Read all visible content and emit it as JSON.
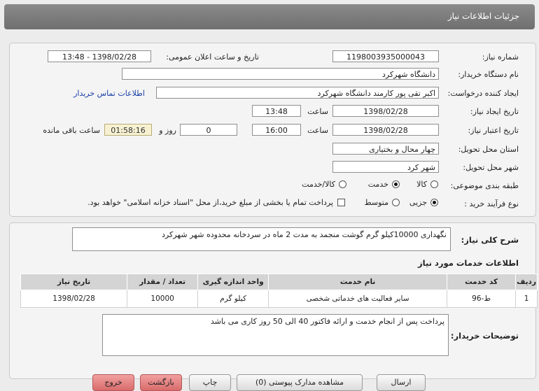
{
  "header": {
    "title": "جزئیات اطلاعات نیاز"
  },
  "form": {
    "need_number_label": "شماره نیاز:",
    "need_number": "1198003935000043",
    "announce_label": "تاریخ و ساعت اعلان عمومی:",
    "announce_value": "1398/02/28 - 13:48",
    "buyer_label": "نام دستگاه خریدار:",
    "buyer": "دانشگاه شهرکرد",
    "creator_label": "ایجاد کننده درخواست:",
    "creator": "اکبر تقی پور کارمند دانشگاه شهرکرد",
    "contact_link": "اطلاعات تماس خریدار",
    "created_label": "تاریخ ایجاد نیاز:",
    "created_date": "1398/02/28",
    "time_word": "ساعت",
    "created_time": "13:48",
    "valid_label": "تاریخ اعتبار نیاز:",
    "valid_date": "1398/02/28",
    "valid_time": "16:00",
    "days": "0",
    "days_word": "روز و",
    "remaining": "01:58:16",
    "remaining_label": "ساعت باقی مانده",
    "province_label": "استان محل تحویل:",
    "province": "چهار محال و بختیاری",
    "city_label": "شهر محل تحویل:",
    "city": "شهر کرد",
    "category_label": "طبقه بندی موضوعی:",
    "category_options": [
      "کالا",
      "خدمت",
      "کالا/خدمت"
    ],
    "category_selected": "خدمت",
    "process_label": "نوع فرآیند خرید :",
    "process_options": [
      "جزیی",
      "متوسط"
    ],
    "process_selected": "جزیی",
    "payment_note": "پرداخت تمام یا بخشی از مبلغ خرید،از محل \"اسناد خزانه اسلامی\" خواهد بود."
  },
  "description": {
    "label": "شرح کلی نیاز:",
    "text": "نگهداری 10000کیلو گرم گوشت منجمد به مدت 2 ماه در سردخانه محدوده شهر شهرکرد"
  },
  "services": {
    "title": "اطلاعات خدمات مورد نیاز",
    "columns": [
      "ردیف",
      "کد خدمت",
      "نام خدمت",
      "واحد اندازه گیری",
      "تعداد / مقدار",
      "تاریخ نیاز"
    ],
    "rows": [
      [
        "1",
        "ط-96",
        "سایر فعالیت های خدماتی شخصی",
        "کیلو گرم",
        "10000",
        "1398/02/28"
      ]
    ]
  },
  "buyer_notes": {
    "label": "توضیحات خریدار:",
    "text": "پرداخت پس از انجام خدمت و ارائه فاکتور 40 الی 50 روز کاری می باشد"
  },
  "buttons": {
    "b1": "ارسال",
    "b2": "مشاهده مدارک پیوستی (0)",
    "b3": "چاپ",
    "b4": "بازگشت",
    "b5": "خروج"
  }
}
